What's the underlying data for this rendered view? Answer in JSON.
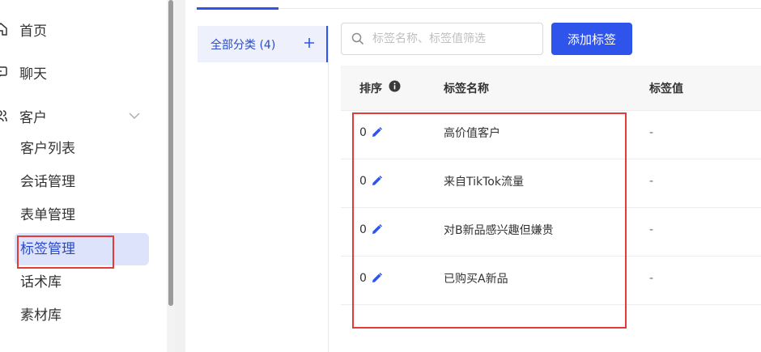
{
  "nav": {
    "home": "首页",
    "chat": "聊天",
    "customer": "客户",
    "sub_items": [
      "客户列表",
      "会话管理",
      "表单管理",
      "标签管理",
      "话术库",
      "素材库"
    ]
  },
  "category": {
    "all_label": "全部分类 (4)"
  },
  "search": {
    "placeholder": "标签名称、标签值筛选",
    "value": ""
  },
  "add_button": "添加标签",
  "table": {
    "headers": [
      "排序",
      "标签名称",
      "标签值"
    ],
    "rows": [
      {
        "sort": "0",
        "name": "高价值客户",
        "value": "-"
      },
      {
        "sort": "0",
        "name": "来自TikTok流量",
        "value": "-"
      },
      {
        "sort": "0",
        "name": "对B新品感兴趣但嫌贵",
        "value": "-"
      },
      {
        "sort": "0",
        "name": "已购买A新品",
        "value": "-"
      }
    ]
  },
  "colors": {
    "primary": "#2f54eb",
    "active_nav_bg": "#dde3fb",
    "highlight_box": "#e23b3b"
  },
  "icons": {
    "home": "home-icon",
    "chat": "chat-icon",
    "customer": "users-icon",
    "edit": "pencil-icon",
    "info": "info-icon",
    "search": "search-icon",
    "add": "plus-icon",
    "expand": "chevron-down-icon"
  }
}
